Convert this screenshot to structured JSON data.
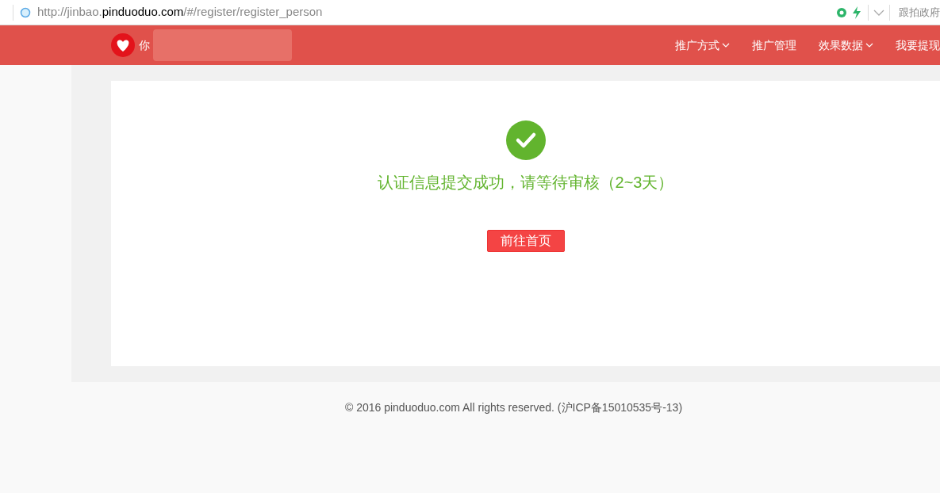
{
  "browser": {
    "url": {
      "prefix": "http://jinbao.",
      "domain": "pinduoduo.com",
      "path": "/#/register/register_person"
    },
    "toolbar_text": "跟拍政府"
  },
  "header": {
    "greeting": "你",
    "nav": [
      {
        "label": "推广方式",
        "has_dropdown": true
      },
      {
        "label": "推广管理",
        "has_dropdown": false
      },
      {
        "label": "效果数据",
        "has_dropdown": true
      },
      {
        "label": "我要提现",
        "has_dropdown": false
      }
    ]
  },
  "result": {
    "message": "认证信息提交成功，请等待审核（2~3天）",
    "button": "前往首页"
  },
  "footer": "© 2016 pinduoduo.com All rights reserved. (沪ICP备15010535号-13)"
}
